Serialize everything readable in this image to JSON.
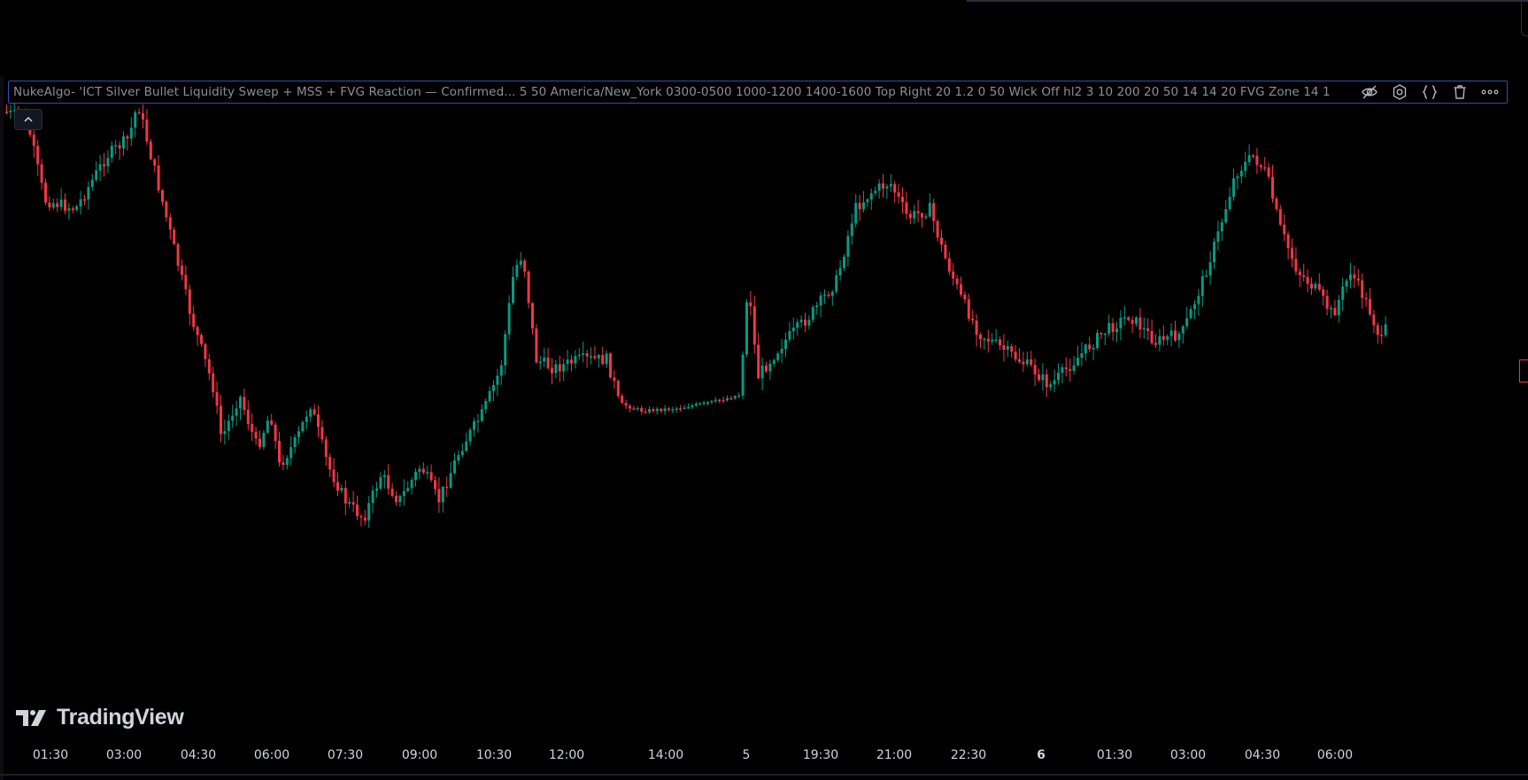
{
  "indicator": {
    "name": "NukeAlgo- 'ICT Silver Bullet Liquidity Sweep + MSS + FVG Reaction — Confirmed...",
    "params": "5 50 America/New_York 0300-0500 1000-1200 1400-1600 Top Right 20 1.2 0 50 Wick Off hl2 3 10 200 20 50 14 14 20 FVG Zone 14 1",
    "action_icons": [
      "eye-off-icon",
      "gear-icon",
      "code-braces-icon",
      "trash-icon",
      "more-icon"
    ]
  },
  "brand": {
    "logo_text": "TradingView"
  },
  "colors": {
    "up": "#089981",
    "down": "#f23645",
    "indicator_border": "#2f4eb5",
    "text": "#d1d4dc"
  },
  "time_axis": {
    "labels": [
      {
        "text": "01:30",
        "bold": false
      },
      {
        "text": "03:00",
        "bold": false
      },
      {
        "text": "04:30",
        "bold": false
      },
      {
        "text": "06:00",
        "bold": false
      },
      {
        "text": "07:30",
        "bold": false
      },
      {
        "text": "09:00",
        "bold": false
      },
      {
        "text": "10:30",
        "bold": false
      },
      {
        "text": "12:00",
        "bold": false
      },
      {
        "text": "14:00",
        "bold": false
      },
      {
        "text": "5",
        "bold": false
      },
      {
        "text": "19:30",
        "bold": false
      },
      {
        "text": "21:00",
        "bold": false
      },
      {
        "text": "22:30",
        "bold": false
      },
      {
        "text": "6",
        "bold": true
      },
      {
        "text": "01:30",
        "bold": false
      },
      {
        "text": "03:00",
        "bold": false
      },
      {
        "text": "04:30",
        "bold": false
      },
      {
        "text": "06:00",
        "bold": false
      }
    ]
  }
}
